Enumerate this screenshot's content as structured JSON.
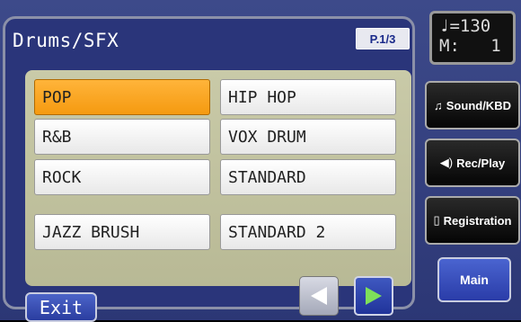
{
  "panel": {
    "title": "Drums/SFX",
    "page": "P.1/3",
    "items": [
      {
        "label": "POP",
        "selected": true
      },
      {
        "label": "HIP HOP",
        "selected": false
      },
      {
        "label": "R&B",
        "selected": false
      },
      {
        "label": "VOX DRUM",
        "selected": false
      },
      {
        "label": "ROCK",
        "selected": false
      },
      {
        "label": "STANDARD",
        "selected": false
      },
      {
        "label": "JAZZ BRUSH",
        "selected": false
      },
      {
        "label": "STANDARD 2",
        "selected": false
      }
    ],
    "exit_label": "Exit"
  },
  "status": {
    "tempo_line": "♩=130",
    "measure_line": "M:   1"
  },
  "side": {
    "sound_kbd": "Sound/KBD",
    "rec_play": "Rec/Play",
    "registration": "Registration",
    "main": "Main"
  },
  "colors": {
    "selected": "#f59a10",
    "panel_bg": "#2a357a",
    "accent": "#3f58c0"
  }
}
